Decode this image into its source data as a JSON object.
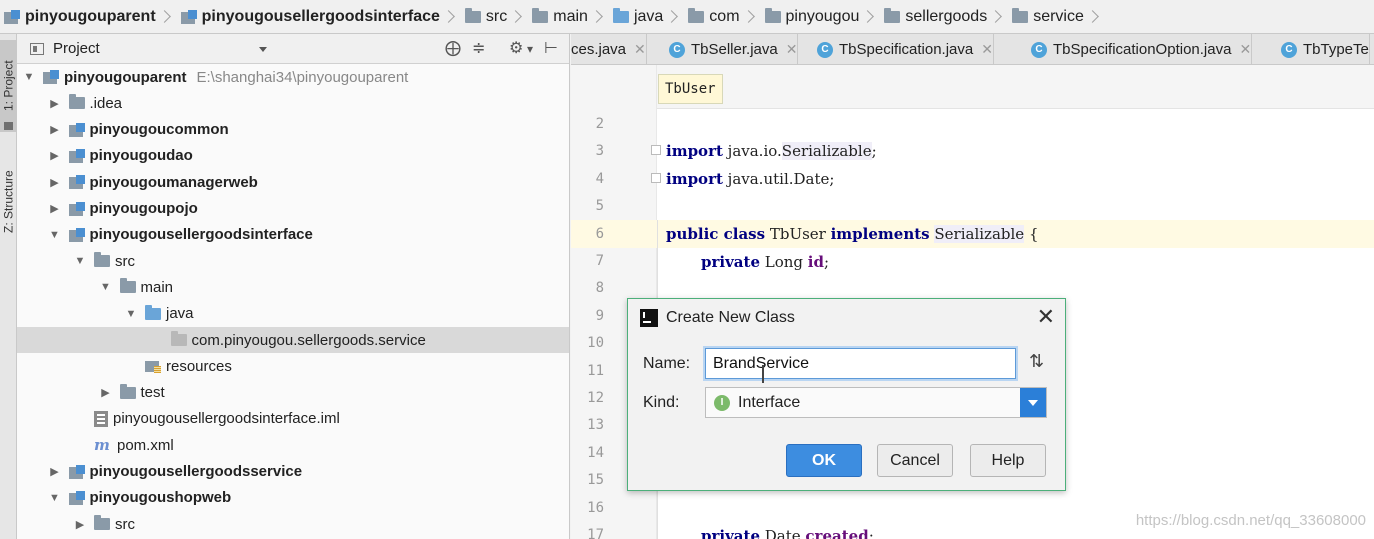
{
  "breadcrumb": [
    {
      "label": "pinyougouparent",
      "icon": "module-icon",
      "bold": true
    },
    {
      "label": "pinyougousellergoodsinterface",
      "icon": "module-icon",
      "bold": true
    },
    {
      "label": "src",
      "icon": "folder-icon"
    },
    {
      "label": "main",
      "icon": "folder-icon"
    },
    {
      "label": "java",
      "icon": "source-folder-icon"
    },
    {
      "label": "com",
      "icon": "package-icon"
    },
    {
      "label": "pinyougou",
      "icon": "package-icon"
    },
    {
      "label": "sellergoods",
      "icon": "package-icon"
    },
    {
      "label": "service",
      "icon": "package-icon"
    }
  ],
  "stripe": {
    "project_tab": "1: Project",
    "structure_tab": "Z: Structure"
  },
  "project_panel": {
    "title": "Project",
    "tree": [
      {
        "label": "pinyougouparent",
        "hint": "E:\\shanghai34\\pinyougouparent",
        "depth": 0,
        "arrow": "down",
        "icon": "module",
        "bold": true
      },
      {
        "label": ".idea",
        "depth": 1,
        "arrow": "right",
        "icon": "folder"
      },
      {
        "label": "pinyougoucommon",
        "depth": 1,
        "arrow": "right",
        "icon": "module",
        "bold": true
      },
      {
        "label": "pinyougoudao",
        "depth": 1,
        "arrow": "right",
        "icon": "module",
        "bold": true
      },
      {
        "label": "pinyougoumanagerweb",
        "depth": 1,
        "arrow": "right",
        "icon": "module",
        "bold": true
      },
      {
        "label": "pinyougoupojo",
        "depth": 1,
        "arrow": "right",
        "icon": "module",
        "bold": true
      },
      {
        "label": "pinyougousellergoodsinterface",
        "depth": 1,
        "arrow": "down",
        "icon": "module",
        "bold": true
      },
      {
        "label": "src",
        "depth": 2,
        "arrow": "down",
        "icon": "folder"
      },
      {
        "label": "main",
        "depth": 3,
        "arrow": "down",
        "icon": "folder"
      },
      {
        "label": "java",
        "depth": 4,
        "arrow": "down",
        "icon": "source"
      },
      {
        "label": "com.pinyougou.sellergoods.service",
        "depth": 5,
        "arrow": "none",
        "icon": "package",
        "selected": true
      },
      {
        "label": "resources",
        "depth": 4,
        "arrow": "none",
        "icon": "resources"
      },
      {
        "label": "test",
        "depth": 3,
        "arrow": "right",
        "icon": "folder"
      },
      {
        "label": "pinyougousellergoodsinterface.iml",
        "depth": 2,
        "arrow": "none",
        "icon": "iml"
      },
      {
        "label": "pom.xml",
        "depth": 2,
        "arrow": "none",
        "icon": "maven"
      },
      {
        "label": "pinyougousellergoodsservice",
        "depth": 1,
        "arrow": "right",
        "icon": "module",
        "bold": true
      },
      {
        "label": "pinyougoushopweb",
        "depth": 1,
        "arrow": "down",
        "icon": "module",
        "bold": true
      },
      {
        "label": "src",
        "depth": 2,
        "arrow": "right",
        "icon": "folder"
      }
    ]
  },
  "tabs": [
    {
      "label": "ces.java",
      "icon": false
    },
    {
      "label": "TbSeller.java",
      "icon": true
    },
    {
      "label": "TbSpecification.java",
      "icon": true
    },
    {
      "label": "TbSpecificationOption.java",
      "icon": true
    },
    {
      "label": "TbTypeTe",
      "icon": true
    }
  ],
  "editor": {
    "crumb_chip": "TbUser",
    "line_numbers": [
      "2",
      "3",
      "4",
      "5",
      "6",
      "7",
      "8",
      "9",
      "10",
      "11",
      "12",
      "13",
      "14",
      "15",
      "16",
      "17"
    ],
    "line3": {
      "kw": "import",
      "pkg": " java.io.",
      "cls": "Serializable",
      "end": ";"
    },
    "line4": {
      "kw": "import",
      "rest": " java.util.Date;"
    },
    "line6": {
      "kw1": "public class",
      "name": " TbUser ",
      "kw2": "implements",
      "sp": " ",
      "iface": "Serializable",
      "end": " {"
    },
    "line7": {
      "kw": "private",
      "type": " Long ",
      "field": "id",
      "end": ";"
    },
    "line17": {
      "kw": "private",
      "type": " Date ",
      "field": "created",
      "end": ";"
    },
    "watermark": "https://blog.csdn.net/qq_33608000"
  },
  "dialog": {
    "title": "Create New Class",
    "name_label": "Name:",
    "name_value": "BrandService",
    "kind_label": "Kind:",
    "kind_value": "Interface",
    "ok": "OK",
    "cancel": "Cancel",
    "help": "Help"
  },
  "colors": {
    "accent": "#3d8de0",
    "dialog_border": "#4caf7a",
    "keyword": "#000080",
    "field": "#660e7a"
  }
}
